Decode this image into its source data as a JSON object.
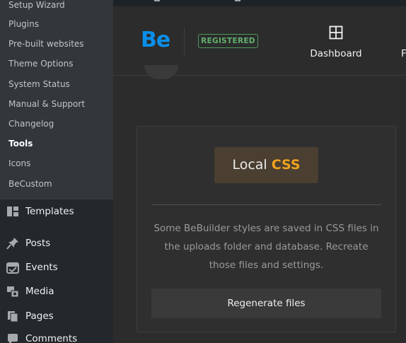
{
  "sidebar": {
    "submenu": [
      {
        "label": "Setup Wizard",
        "active": false
      },
      {
        "label": "Plugins",
        "active": false
      },
      {
        "label": "Pre-built websites",
        "active": false
      },
      {
        "label": "Theme Options",
        "active": false
      },
      {
        "label": "System Status",
        "active": false
      },
      {
        "label": "Manual & Support",
        "active": false
      },
      {
        "label": "Changelog",
        "active": false
      },
      {
        "label": "Tools",
        "active": true
      },
      {
        "label": "Icons",
        "active": false
      },
      {
        "label": "BeCustom",
        "active": false
      }
    ],
    "menu": [
      {
        "label": "Templates",
        "icon": "templates-icon"
      },
      {
        "label": "Posts",
        "icon": "pin-icon"
      },
      {
        "label": "Events",
        "icon": "calendar-icon"
      },
      {
        "label": "Media",
        "icon": "media-icon"
      },
      {
        "label": "Pages",
        "icon": "pages-icon"
      },
      {
        "label": "Comments",
        "icon": "comments-icon"
      }
    ]
  },
  "header": {
    "logo": "Be",
    "badge": "REGISTERED",
    "tabs": [
      {
        "label": "Dashboard",
        "icon": "dashboard-grid-icon"
      }
    ],
    "next_tab_partial": "F"
  },
  "card": {
    "title_part1": "Local ",
    "title_part2": "CSS",
    "description": "Some BeBuilder styles are saved in CSS files in the uploads folder and database. Recreate those files and settings.",
    "button_label": "Regenerate files"
  },
  "colors": {
    "brand_blue": "#0a8fe9",
    "accent_orange": "#f0a31f",
    "registered_green": "#62b16e",
    "sidebar_bg": "#23282d",
    "submenu_bg": "#32373c",
    "content_bg": "#2c2c2c"
  }
}
